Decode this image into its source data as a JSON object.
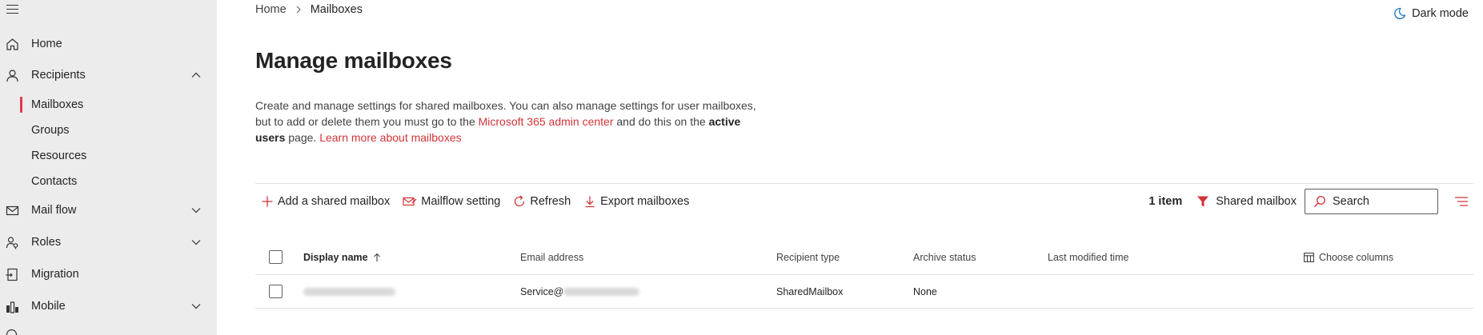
{
  "sidebar": {
    "items": [
      {
        "label": "Home",
        "icon": "home-icon"
      },
      {
        "label": "Recipients",
        "icon": "person-icon",
        "expanded": true
      },
      {
        "label": "Mail flow",
        "icon": "mail-icon",
        "expanded": false
      },
      {
        "label": "Roles",
        "icon": "roles-icon",
        "expanded": false
      },
      {
        "label": "Migration",
        "icon": "migration-icon"
      },
      {
        "label": "Mobile",
        "icon": "mobile-icon",
        "expanded": false
      }
    ],
    "recipients_sub": [
      {
        "label": "Mailboxes",
        "selected": true
      },
      {
        "label": "Groups"
      },
      {
        "label": "Resources"
      },
      {
        "label": "Contacts"
      }
    ]
  },
  "breadcrumb": {
    "home": "Home",
    "current": "Mailboxes"
  },
  "header": {
    "dark_mode_label": "Dark mode"
  },
  "page": {
    "title": "Manage mailboxes",
    "desc_part1": "Create and manage settings for shared mailboxes. You can also manage settings for user mailboxes, but to add or delete them you must go to the ",
    "desc_link1": "Microsoft 365 admin center",
    "desc_part2": " and do this on the ",
    "desc_bold": "active users",
    "desc_part3": " page. ",
    "desc_link2": "Learn more about mailboxes"
  },
  "toolbar": {
    "add_label": "Add a shared mailbox",
    "mailflow_label": "Mailflow setting",
    "refresh_label": "Refresh",
    "export_label": "Export mailboxes",
    "count_label": "1 item",
    "filter_label": "Shared mailbox",
    "search_placeholder": "Search"
  },
  "table": {
    "columns": {
      "display_name": "Display name",
      "email": "Email address",
      "recipient_type": "Recipient type",
      "archive_status": "Archive status",
      "last_modified": "Last modified time",
      "choose_columns": "Choose columns"
    },
    "rows": [
      {
        "email_prefix": "Service@",
        "recipient_type": "SharedMailbox",
        "archive_status": "None"
      }
    ]
  },
  "colors": {
    "accent": "#e23b4c",
    "link": "#d13438",
    "sidebar_bg": "#ececec"
  }
}
